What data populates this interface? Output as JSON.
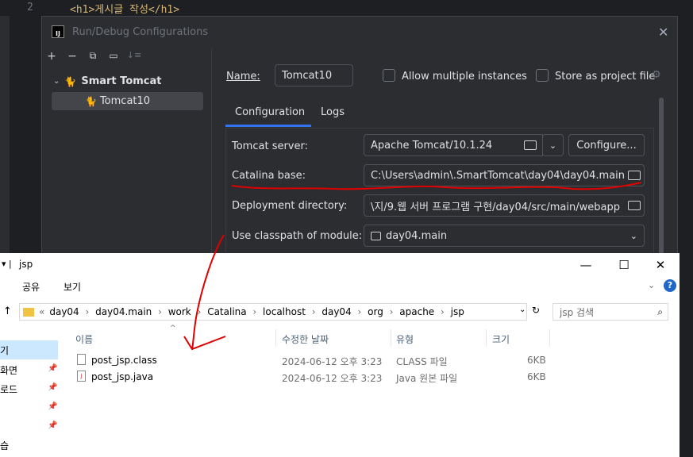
{
  "editor": {
    "line_number": "2",
    "code": "<h1>게시글 작성</h1>"
  },
  "dialog": {
    "title": "Run/Debug Configurations",
    "logo_text": "IJ",
    "toolbar_icons": [
      "add-icon",
      "remove-icon",
      "copy-icon",
      "new-folder-icon",
      "sort-icon"
    ],
    "tree": {
      "parent_label": "Smart Tomcat",
      "child_label": "Tomcat10"
    },
    "name_label": "Name:",
    "name_value": "Tomcat10",
    "allow_multiple_label": "Allow multiple instances",
    "store_project_label": "Store as project file",
    "tabs": [
      "Configuration",
      "Logs"
    ],
    "tomcat_server_label": "Tomcat server:",
    "tomcat_server_value": "Apache Tomcat/10.1.24",
    "configure_label": "Configure...",
    "catalina_base_label": "Catalina base:",
    "catalina_base_value": "C:\\Users\\admin\\.SmartTomcat\\day04\\day04.main",
    "deployment_dir_label": "Deployment directory:",
    "deployment_dir_value": "\\지/9.웹 서버 프로그램 구현/day04/src/main/webapp",
    "classpath_label": "Use classpath of module:",
    "classpath_value": "day04.main"
  },
  "explorer": {
    "title": "jsp",
    "ribbon": [
      "공유",
      "보기"
    ],
    "breadcrumb": [
      "day04",
      "day04.main",
      "work",
      "Catalina",
      "localhost",
      "day04",
      "org",
      "apache",
      "jsp"
    ],
    "search_placeholder": "jsp 검색",
    "columns": {
      "name": "이름",
      "modified": "수정한 날짜",
      "type": "유형",
      "size": "크기"
    },
    "nav_items": [
      "기",
      "화면",
      "로드",
      "",
      "",
      "습"
    ],
    "files": [
      {
        "name": "post_jsp.class",
        "modified": "2024-06-12 오후 3:23",
        "type": "CLASS 파일",
        "size": "6KB"
      },
      {
        "name": "post_jsp.java",
        "modified": "2024-06-12 오후 3:23",
        "type": "Java 원본 파일",
        "size": "6KB"
      }
    ]
  },
  "colors": {
    "accent": "#3574f0",
    "annotation": "#e00000"
  }
}
